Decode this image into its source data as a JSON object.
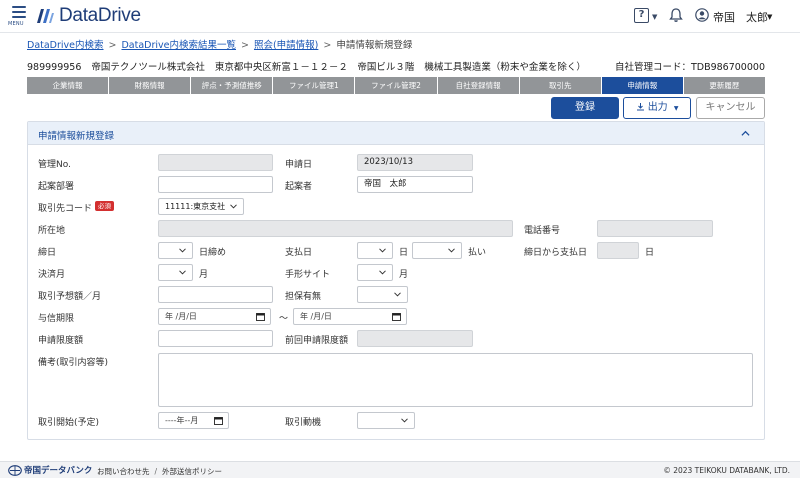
{
  "header": {
    "menu_label": "MENU",
    "logo_text": "DataDrive",
    "help_label": "?",
    "user_name": "帝国　太郎"
  },
  "breadcrumb": {
    "items": [
      "DataDrive内検索",
      "DataDrive内検索結果一覧",
      "照会(申請情報)"
    ],
    "current": "申請情報新規登録",
    "separator": ">"
  },
  "company": {
    "code": "989999956",
    "name": "帝国テクノツール株式会社",
    "address": "東京都中央区新富１－１２－２　帝国ビル３階",
    "industry": "機械工具製造業（粉末や金業を除く）",
    "mgmt_code": "自社管理コード：TDB986700000"
  },
  "tabs": [
    {
      "label": "企業情報",
      "active": false
    },
    {
      "label": "財務情報",
      "active": false
    },
    {
      "label": "評点・予測値推移",
      "active": false
    },
    {
      "label": "ファイル管理1",
      "active": false
    },
    {
      "label": "ファイル管理2",
      "active": false
    },
    {
      "label": "自社登録情報",
      "active": false
    },
    {
      "label": "取引先",
      "active": false
    },
    {
      "label": "申請情報",
      "active": true
    },
    {
      "label": "更新履歴",
      "active": false
    }
  ],
  "actions": {
    "register": "登録",
    "output": "出力",
    "cancel": "キャンセル"
  },
  "panel": {
    "title": "申請情報新規登録"
  },
  "form": {
    "mgmt_no": {
      "label": "管理No.",
      "value": ""
    },
    "apply_date": {
      "label": "申請日",
      "value": "2023/10/13"
    },
    "dept": {
      "label": "起案部署",
      "value": ""
    },
    "drafter": {
      "label": "起案者",
      "value": "帝国　太郎"
    },
    "client_code": {
      "label": "取引先コード",
      "required": "必須",
      "value": "11111:東京支社"
    },
    "address": {
      "label": "所在地",
      "value": ""
    },
    "phone": {
      "label": "電話番号",
      "value": ""
    },
    "closing_day": {
      "label": "締日",
      "unit": "日締め"
    },
    "payment_day": {
      "label": "支払日",
      "unit_day": "日",
      "unit_pay": "払い"
    },
    "days_to_payment": {
      "label": "締日から支払日",
      "unit": "日",
      "value": ""
    },
    "settlement_month": {
      "label": "決済月",
      "unit": "月"
    },
    "bill_site": {
      "label": "手形サイト",
      "unit": "月"
    },
    "expected_amount": {
      "label": "取引予想額／月",
      "value": ""
    },
    "collateral": {
      "label": "担保有無"
    },
    "credit_period": {
      "label": "与信期限",
      "from_placeholder": "年 /月/日",
      "tilde": "～",
      "to_placeholder": "年 /月/日"
    },
    "limit_amount": {
      "label": "申請限度額",
      "value": ""
    },
    "prev_limit": {
      "label": "前回申請限度額",
      "value": ""
    },
    "remarks": {
      "label": "備考(取引内容等)"
    },
    "start": {
      "label": "取引開始(予定)",
      "placeholder": "----年--月"
    },
    "motive": {
      "label": "取引動機"
    }
  },
  "footer": {
    "logo_text": "帝国データバンク",
    "contact": "お問い合わせ先",
    "divider": "/",
    "policy": "外部送信ポリシー",
    "copyright": "© 2023 TEIKOKU DATABANK, LTD."
  },
  "colors": {
    "brand": "#1c4e9c",
    "tab_inactive": "#929598",
    "required": "#d32f2f",
    "panel_head": "#e9f0f9"
  }
}
